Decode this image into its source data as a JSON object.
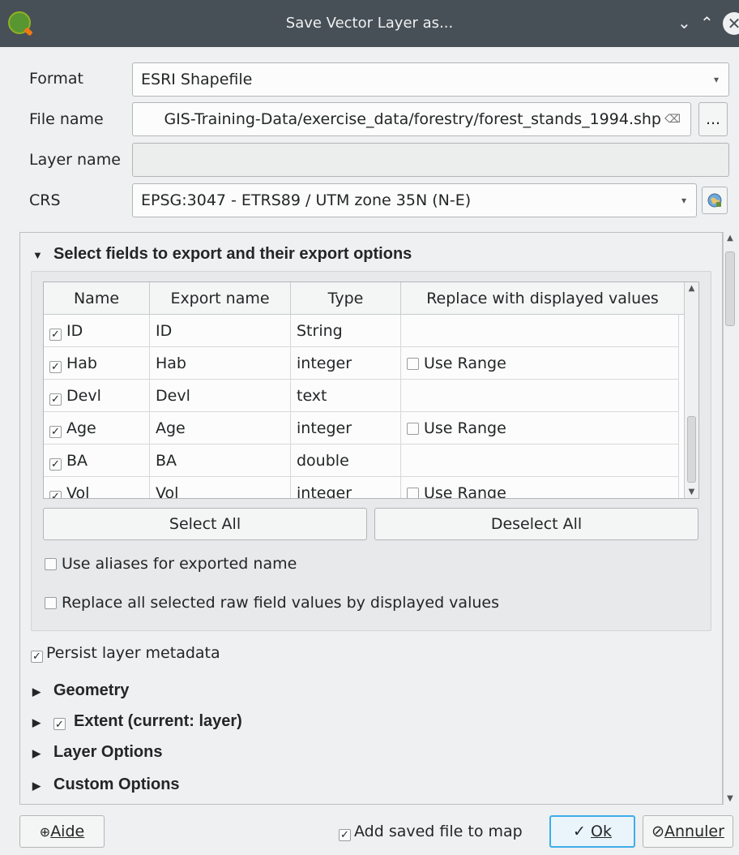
{
  "window": {
    "title": "Save Vector Layer as..."
  },
  "form": {
    "format_label": "Format",
    "format_value": "ESRI Shapefile",
    "filename_label": "File name",
    "filename_value": "GIS-Training-Data/exercise_data/forestry/forest_stands_1994.shp",
    "browse_label": "...",
    "layername_label": "Layer name",
    "layername_value": "",
    "crs_label": "CRS",
    "crs_value": "EPSG:3047 - ETRS89 / UTM zone 35N (N-E)"
  },
  "fields_section": {
    "title": "Select fields to export and their export options",
    "columns": [
      "Name",
      "Export name",
      "Type",
      "Replace with displayed values"
    ],
    "rows": [
      {
        "name": "ID",
        "export": "ID",
        "type": "String",
        "replace": ""
      },
      {
        "name": "Hab",
        "export": "Hab",
        "type": "integer",
        "replace": "Use Range"
      },
      {
        "name": "Devl",
        "export": "Devl",
        "type": "text",
        "replace": ""
      },
      {
        "name": "Age",
        "export": "Age",
        "type": "integer",
        "replace": "Use Range"
      },
      {
        "name": "BA",
        "export": "BA",
        "type": "double",
        "replace": ""
      },
      {
        "name": "Vol",
        "export": "Vol",
        "type": "integer",
        "replace": "Use Range"
      }
    ],
    "select_all": "Select All",
    "deselect_all": "Deselect All",
    "use_aliases": "Use aliases for exported name",
    "replace_all": "Replace all selected raw field values by displayed values"
  },
  "persist_metadata": "Persist layer metadata",
  "sections": {
    "geometry": "Geometry",
    "extent": "Extent (current: layer)",
    "layer_options": "Layer Options",
    "custom_options": "Custom Options"
  },
  "footer": {
    "help": "Aide",
    "add_to_map": "Add saved file to map",
    "ok": "Ok",
    "cancel": "Annuler"
  }
}
